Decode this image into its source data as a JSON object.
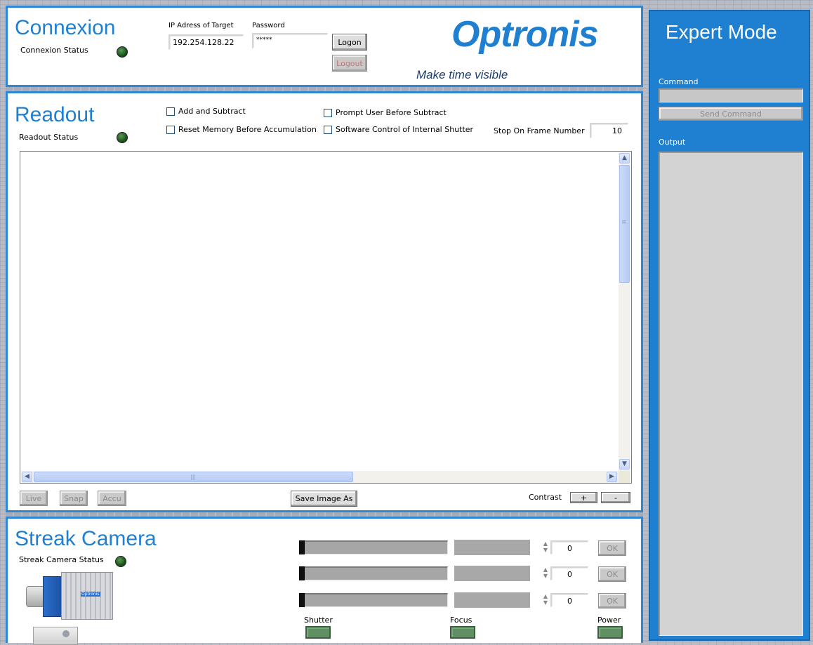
{
  "connexion": {
    "title": "Connexion",
    "status_label": "Connexion Status",
    "ip_label": "IP Adress of Target",
    "ip_value": "192.254.128.22",
    "password_label": "Password",
    "password_value": "*****",
    "logon_label": "Logon",
    "logout_label": "Logout"
  },
  "brand": {
    "logo_text": "Optronis",
    "tagline": "Make time visible",
    "color": "#1f7fd0"
  },
  "readout": {
    "title": "Readout",
    "status_label": "Readout Status",
    "add_subtract_label": "Add and Subtract",
    "reset_memory_label": "Reset Memory Before Accumulation",
    "prompt_user_label": "Prompt User Before Subtract",
    "software_control_label": "Software Control of Internal Shutter",
    "stop_frame_label": "Stop On Frame Number",
    "stop_frame_value": "10",
    "live_label": "Live",
    "snap_label": "Snap",
    "accu_label": "Accu",
    "save_image_label": "Save Image As",
    "contrast_label": "Contrast",
    "contrast_plus": "+",
    "contrast_minus": "-"
  },
  "streak": {
    "title": "Streak Camera",
    "status_label": "Streak Camera Status",
    "rows": [
      {
        "value": "0",
        "ok": "OK"
      },
      {
        "value": "0",
        "ok": "OK"
      },
      {
        "value": "0",
        "ok": "OK"
      }
    ],
    "shutter_label": "Shutter",
    "focus_label": "Focus",
    "power_label": "Power",
    "camera_badge": "Optronis"
  },
  "expert": {
    "title": "Expert Mode",
    "command_label": "Command",
    "command_value": "",
    "send_label": "Send Command",
    "output_label": "Output",
    "color": "#1f7fd0"
  },
  "icons": {
    "scroll_up": "▲",
    "scroll_down": "▼",
    "scroll_left": "◀",
    "scroll_right": "▶",
    "grip": "|||",
    "grip_v": "≡",
    "spin_up": "▲",
    "spin_down": "▼"
  }
}
